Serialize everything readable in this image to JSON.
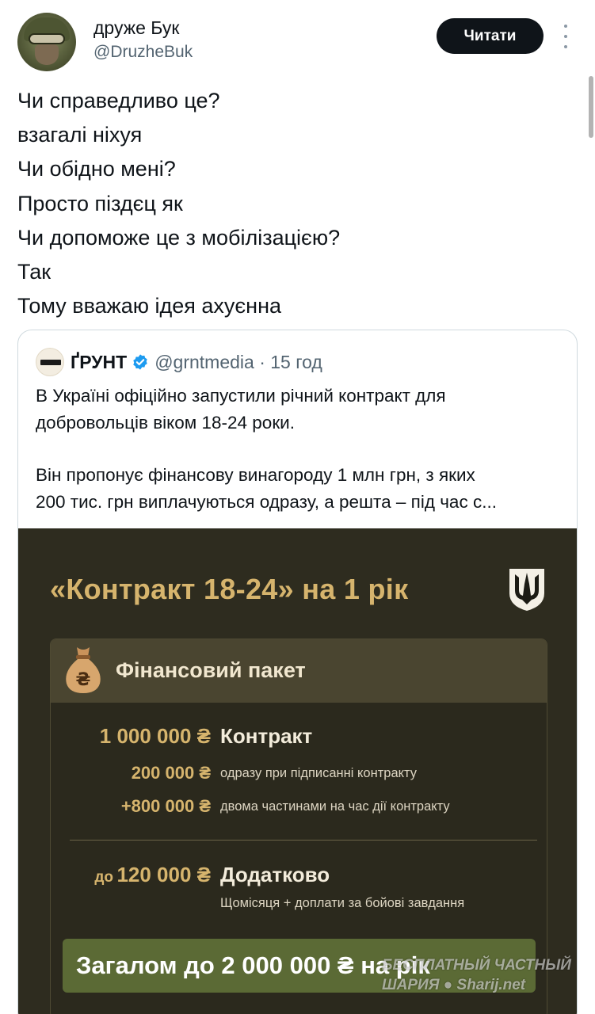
{
  "author": {
    "name": "друже Бук",
    "handle": "@DruzheBuk",
    "follow_label": "Читати"
  },
  "tweet": {
    "lines": [
      "Чи справедливо це?",
      "взагалі ніхуя",
      "Чи обідно мені?",
      "Просто піздєц як",
      "Чи допоможе це з мобілізацією?",
      "Так",
      "Тому вважаю ідея ахуєнна"
    ]
  },
  "quote": {
    "name": "ҐРУНТ",
    "handle": "@grntmedia · 15 год",
    "text_lines": [
      "В Україні офіційно запустили річний контракт для",
      "добровольців віком 18-24 роки.",
      "Він пропонує фінансову винагороду 1 млн грн, з яких",
      "200 тис. грн виплачуються одразу, а решта – під час с..."
    ],
    "media": {
      "title": "«Контракт 18-24» на 1 рік",
      "panel_title": "Фінансовий пакет",
      "contract_amount": "1 000 000 ₴",
      "contract_label": "Контракт",
      "upfront_amount": "200 000 ₴",
      "upfront_label": "одразу при підписанні контракту",
      "rest_amount": "+800 000 ₴",
      "rest_label": "двома частинами на час дії контракту",
      "extra_prefix": "до",
      "extra_amount": "120 000 ₴",
      "extra_label": "Додатково",
      "extra_sub": "Щомісяця + доплати за бойові завдання",
      "total_label": "Загалом до 2 000 000 ₴ на рік"
    }
  },
  "watermark": {
    "line1": "БЕСПЛАТНЫЙ ЧАСТНЫЙ",
    "line2": "ШАРИЯ ● Sharij.net"
  },
  "colors": {
    "gold": "#d6b46d",
    "media_bg": "#2e2c1f",
    "total_green": "#5b6a35"
  }
}
